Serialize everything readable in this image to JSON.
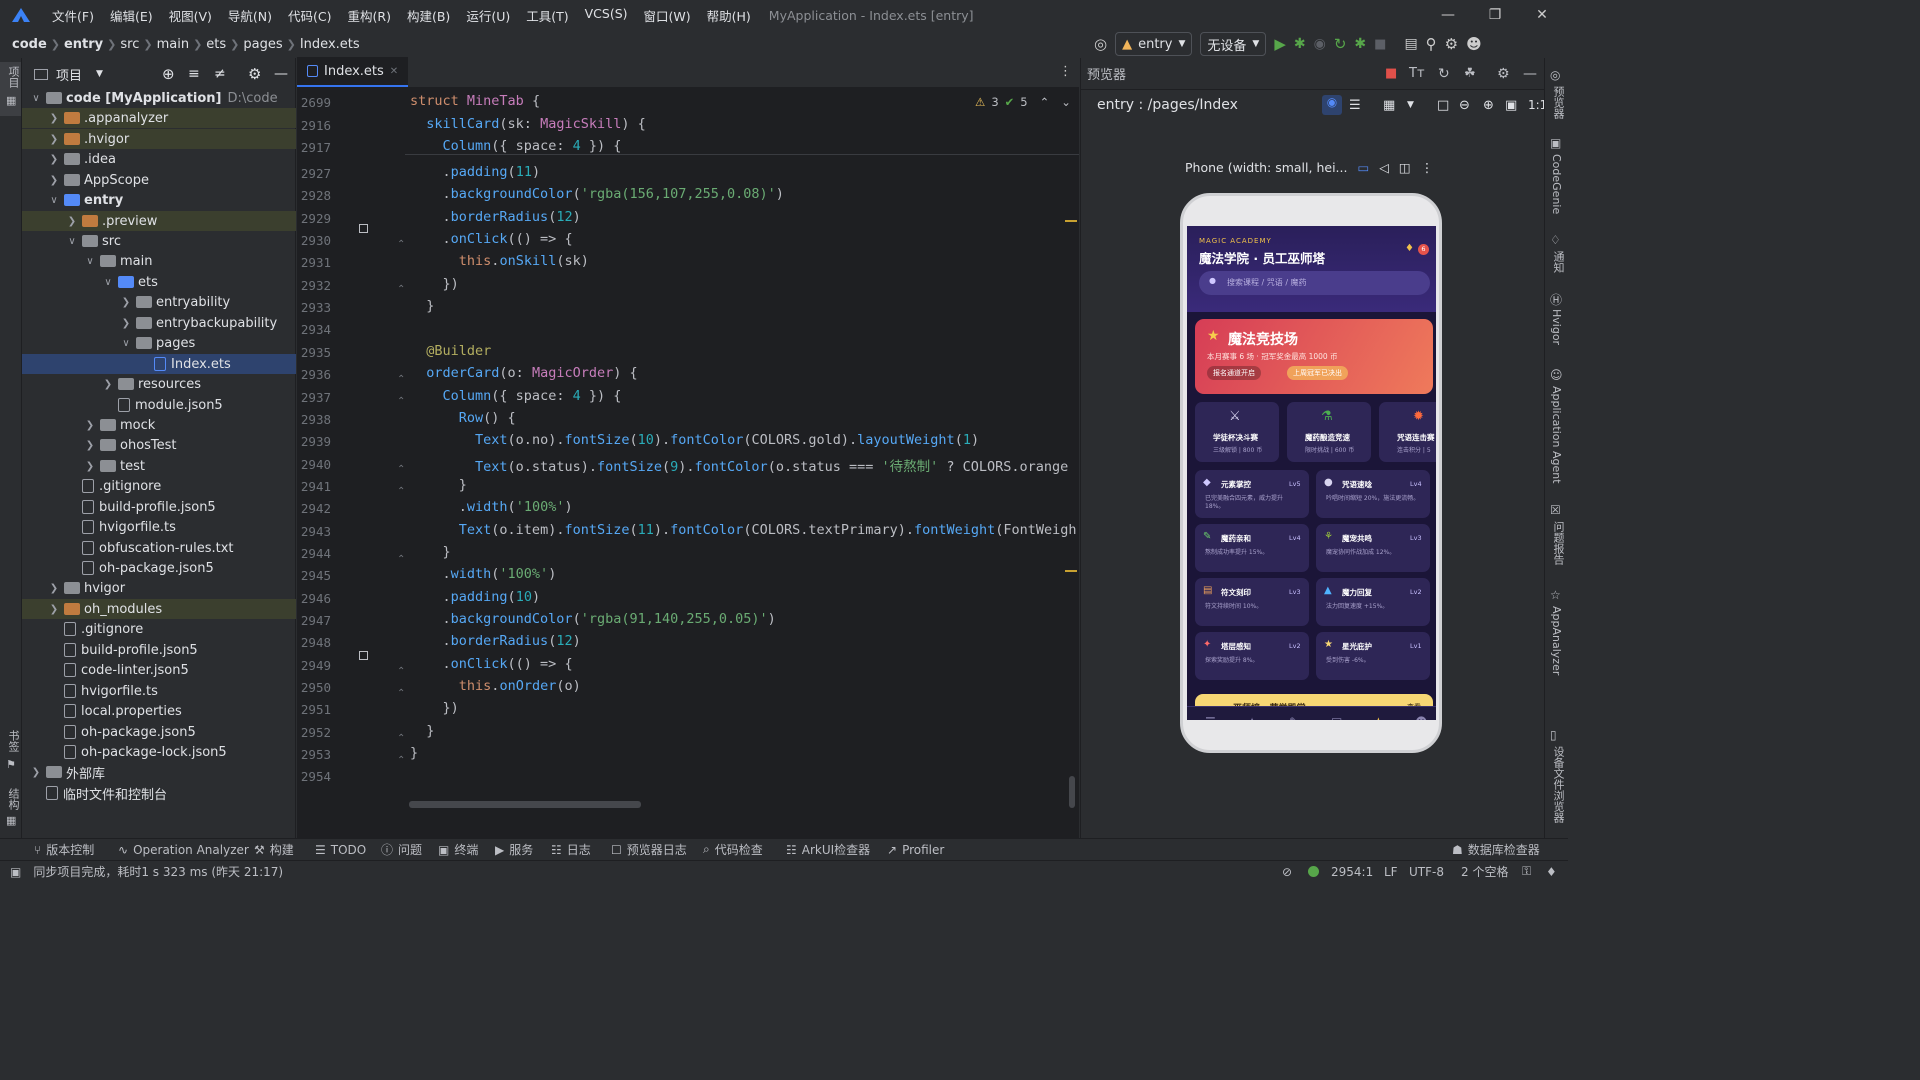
{
  "menubar": {
    "items": [
      "文件(F)",
      "编辑(E)",
      "视图(V)",
      "导航(N)",
      "代码(C)",
      "重构(R)",
      "构建(B)",
      "运行(U)",
      "工具(T)",
      "VCS(S)",
      "窗口(W)",
      "帮助(H)"
    ],
    "window_title": "MyApplication - Index.ets [entry]"
  },
  "breadcrumb": [
    "code",
    "entry",
    "src",
    "main",
    "ets",
    "pages",
    "Index.ets"
  ],
  "toolbar": {
    "run_config": "entry",
    "device": "无设备"
  },
  "project_panel": {
    "title": "项目",
    "tree": [
      {
        "label": "code [MyApplication]",
        "path": "D:\\code",
        "indent": 0,
        "chevron": "down",
        "kind": "folder-plain",
        "style": "bold"
      },
      {
        "label": ".appanalyzer",
        "indent": 1,
        "chevron": "right",
        "kind": "folder-orange",
        "style": "hl"
      },
      {
        "label": ".hvigor",
        "indent": 1,
        "chevron": "right",
        "kind": "folder-orange",
        "style": "hl"
      },
      {
        "label": ".idea",
        "indent": 1,
        "chevron": "right",
        "kind": "folder-plain"
      },
      {
        "label": "AppScope",
        "indent": 1,
        "chevron": "right",
        "kind": "folder-plain"
      },
      {
        "label": "entry",
        "indent": 1,
        "chevron": "down",
        "kind": "folder-blue",
        "style": "bold"
      },
      {
        "label": ".preview",
        "indent": 2,
        "chevron": "right",
        "kind": "folder-orange",
        "style": "hl"
      },
      {
        "label": "src",
        "indent": 2,
        "chevron": "down",
        "kind": "folder-plain"
      },
      {
        "label": "main",
        "indent": 3,
        "chevron": "down",
        "kind": "folder-plain"
      },
      {
        "label": "ets",
        "indent": 4,
        "chevron": "down",
        "kind": "folder-blue"
      },
      {
        "label": "entryability",
        "indent": 5,
        "chevron": "right",
        "kind": "folder-plain"
      },
      {
        "label": "entrybackupability",
        "indent": 5,
        "chevron": "right",
        "kind": "folder-plain"
      },
      {
        "label": "pages",
        "indent": 5,
        "chevron": "down",
        "kind": "folder-plain"
      },
      {
        "label": "Index.ets",
        "indent": 6,
        "chevron": "",
        "kind": "file-blue",
        "style": "sel"
      },
      {
        "label": "resources",
        "indent": 4,
        "chevron": "right",
        "kind": "folder-plain"
      },
      {
        "label": "module.json5",
        "indent": 4,
        "chevron": "",
        "kind": "file"
      },
      {
        "label": "mock",
        "indent": 3,
        "chevron": "right",
        "kind": "folder-plain"
      },
      {
        "label": "ohosTest",
        "indent": 3,
        "chevron": "right",
        "kind": "folder-plain"
      },
      {
        "label": "test",
        "indent": 3,
        "chevron": "right",
        "kind": "folder-plain"
      },
      {
        "label": ".gitignore",
        "indent": 2,
        "chevron": "",
        "kind": "file"
      },
      {
        "label": "build-profile.json5",
        "indent": 2,
        "chevron": "",
        "kind": "file"
      },
      {
        "label": "hvigorfile.ts",
        "indent": 2,
        "chevron": "",
        "kind": "file"
      },
      {
        "label": "obfuscation-rules.txt",
        "indent": 2,
        "chevron": "",
        "kind": "file"
      },
      {
        "label": "oh-package.json5",
        "indent": 2,
        "chevron": "",
        "kind": "file"
      },
      {
        "label": "hvigor",
        "indent": 1,
        "chevron": "right",
        "kind": "folder-plain"
      },
      {
        "label": "oh_modules",
        "indent": 1,
        "chevron": "right",
        "kind": "folder-orange",
        "style": "hl"
      },
      {
        "label": ".gitignore",
        "indent": 1,
        "chevron": "",
        "kind": "file"
      },
      {
        "label": "build-profile.json5",
        "indent": 1,
        "chevron": "",
        "kind": "file"
      },
      {
        "label": "code-linter.json5",
        "indent": 1,
        "chevron": "",
        "kind": "file"
      },
      {
        "label": "hvigorfile.ts",
        "indent": 1,
        "chevron": "",
        "kind": "file"
      },
      {
        "label": "local.properties",
        "indent": 1,
        "chevron": "",
        "kind": "file"
      },
      {
        "label": "oh-package.json5",
        "indent": 1,
        "chevron": "",
        "kind": "file"
      },
      {
        "label": "oh-package-lock.json5",
        "indent": 1,
        "chevron": "",
        "kind": "file"
      },
      {
        "label": "外部库",
        "indent": 0,
        "chevron": "right",
        "kind": "folder-plain"
      },
      {
        "label": "临时文件和控制台",
        "indent": 0,
        "chevron": "",
        "kind": "file"
      }
    ]
  },
  "left_strip": {
    "project": "项目",
    "bookmarks": "书签",
    "structure": "结构"
  },
  "editor": {
    "tab": "Index.ets",
    "inspections": {
      "warnings": "3",
      "ok": "5"
    },
    "sticky": [
      {
        "ln": "2699",
        "tokens": [
          [
            "kw",
            "struct "
          ],
          [
            "ty",
            "MineTab "
          ],
          [
            "cls",
            "{"
          ]
        ]
      },
      {
        "ln": "2916",
        "tokens": [
          [
            "cls",
            "  "
          ],
          [
            "fn",
            "skillCard"
          ],
          [
            "cls",
            "(sk: "
          ],
          [
            "ty",
            "MagicSkill"
          ],
          [
            "cls",
            ") {"
          ]
        ]
      },
      {
        "ln": "2917",
        "tokens": [
          [
            "cls",
            "    "
          ],
          [
            "fn",
            "Column"
          ],
          [
            "cls",
            "({ space: "
          ],
          [
            "num",
            "4"
          ],
          [
            "cls",
            " }) {"
          ]
        ]
      }
    ],
    "lines": [
      {
        "ln": "2927",
        "tokens": [
          [
            "cls",
            "    ."
          ],
          [
            "fn",
            "padding"
          ],
          [
            "cls",
            "("
          ],
          [
            "num",
            "11"
          ],
          [
            "cls",
            ")"
          ]
        ]
      },
      {
        "ln": "2928",
        "tokens": [
          [
            "cls",
            "    ."
          ],
          [
            "fn",
            "backgroundColor"
          ],
          [
            "cls",
            "("
          ],
          [
            "str",
            "'rgba(156,107,255,0.08)'"
          ],
          [
            "cls",
            ")"
          ]
        ]
      },
      {
        "ln": "2929",
        "tokens": [
          [
            "cls",
            "    ."
          ],
          [
            "fn",
            "borderRadius"
          ],
          [
            "cls",
            "("
          ],
          [
            "num",
            "12"
          ],
          [
            "cls",
            ")"
          ]
        ]
      },
      {
        "ln": "2930",
        "tokens": [
          [
            "cls",
            "    ."
          ],
          [
            "fn",
            "onClick"
          ],
          [
            "cls",
            "(() => {"
          ]
        ]
      },
      {
        "ln": "2931",
        "tokens": [
          [
            "cls",
            "      "
          ],
          [
            "kw",
            "this"
          ],
          [
            "cls",
            "."
          ],
          [
            "fn",
            "onSkill"
          ],
          [
            "cls",
            "(sk)"
          ]
        ]
      },
      {
        "ln": "2932",
        "tokens": [
          [
            "cls",
            "    })"
          ]
        ]
      },
      {
        "ln": "2933",
        "tokens": [
          [
            "cls",
            "  }"
          ]
        ]
      },
      {
        "ln": "2934",
        "tokens": [
          [
            "cls",
            ""
          ]
        ]
      },
      {
        "ln": "2935",
        "tokens": [
          [
            "cls",
            "  "
          ],
          [
            "ann",
            "@Builder"
          ]
        ]
      },
      {
        "ln": "2936",
        "tokens": [
          [
            "cls",
            "  "
          ],
          [
            "fn",
            "orderCard"
          ],
          [
            "cls",
            "(o: "
          ],
          [
            "ty",
            "MagicOrder"
          ],
          [
            "cls",
            ") {"
          ]
        ]
      },
      {
        "ln": "2937",
        "tokens": [
          [
            "cls",
            "    "
          ],
          [
            "fn",
            "Column"
          ],
          [
            "cls",
            "({ space: "
          ],
          [
            "num",
            "4"
          ],
          [
            "cls",
            " }) {"
          ]
        ]
      },
      {
        "ln": "2938",
        "tokens": [
          [
            "cls",
            "      "
          ],
          [
            "fn",
            "Row"
          ],
          [
            "cls",
            "() {"
          ]
        ]
      },
      {
        "ln": "2939",
        "tokens": [
          [
            "cls",
            "        "
          ],
          [
            "fn",
            "Text"
          ],
          [
            "cls",
            "(o."
          ],
          [
            "cls",
            "no"
          ],
          [
            "cls",
            ")."
          ],
          [
            "fn",
            "fontSize"
          ],
          [
            "cls",
            "("
          ],
          [
            "num",
            "10"
          ],
          [
            "cls",
            ")."
          ],
          [
            "fn",
            "fontColor"
          ],
          [
            "cls",
            "(COLORS."
          ],
          [
            "cls",
            "gold"
          ],
          [
            "cls",
            ")."
          ],
          [
            "fn",
            "layoutWeight"
          ],
          [
            "cls",
            "("
          ],
          [
            "num",
            "1"
          ],
          [
            "cls",
            ")"
          ]
        ]
      },
      {
        "ln": "2940",
        "tokens": [
          [
            "cls",
            "        "
          ],
          [
            "fn",
            "Text"
          ],
          [
            "cls",
            "(o.status)."
          ],
          [
            "fn",
            "fontSize"
          ],
          [
            "cls",
            "("
          ],
          [
            "num",
            "9"
          ],
          [
            "cls",
            ")."
          ],
          [
            "fn",
            "fontColor"
          ],
          [
            "cls",
            "(o.status === "
          ],
          [
            "str",
            "'待熬制'"
          ],
          [
            "cls",
            " ? COLORS.orange"
          ]
        ]
      },
      {
        "ln": "2941",
        "tokens": [
          [
            "cls",
            "      }"
          ]
        ]
      },
      {
        "ln": "2942",
        "tokens": [
          [
            "cls",
            "      ."
          ],
          [
            "fn",
            "width"
          ],
          [
            "cls",
            "("
          ],
          [
            "str",
            "'100%'"
          ],
          [
            "cls",
            ")"
          ]
        ]
      },
      {
        "ln": "2943",
        "tokens": [
          [
            "cls",
            "      "
          ],
          [
            "fn",
            "Text"
          ],
          [
            "cls",
            "(o.item)."
          ],
          [
            "fn",
            "fontSize"
          ],
          [
            "cls",
            "("
          ],
          [
            "num",
            "11"
          ],
          [
            "cls",
            ")."
          ],
          [
            "fn",
            "fontColor"
          ],
          [
            "cls",
            "(COLORS.textPrimary)."
          ],
          [
            "fn",
            "fontWeight"
          ],
          [
            "cls",
            "(FontWeigh"
          ]
        ]
      },
      {
        "ln": "2944",
        "tokens": [
          [
            "cls",
            "    }"
          ]
        ]
      },
      {
        "ln": "2945",
        "tokens": [
          [
            "cls",
            "    ."
          ],
          [
            "fn",
            "width"
          ],
          [
            "cls",
            "("
          ],
          [
            "str",
            "'100%'"
          ],
          [
            "cls",
            ")"
          ]
        ]
      },
      {
        "ln": "2946",
        "tokens": [
          [
            "cls",
            "    ."
          ],
          [
            "fn",
            "padding"
          ],
          [
            "cls",
            "("
          ],
          [
            "num",
            "10"
          ],
          [
            "cls",
            ")"
          ]
        ]
      },
      {
        "ln": "2947",
        "tokens": [
          [
            "cls",
            "    ."
          ],
          [
            "fn",
            "backgroundColor"
          ],
          [
            "cls",
            "("
          ],
          [
            "str",
            "'rgba(91,140,255,0.05)'"
          ],
          [
            "cls",
            ")"
          ]
        ]
      },
      {
        "ln": "2948",
        "tokens": [
          [
            "cls",
            "    ."
          ],
          [
            "fn",
            "borderRadius"
          ],
          [
            "cls",
            "("
          ],
          [
            "num",
            "12"
          ],
          [
            "cls",
            ")"
          ]
        ]
      },
      {
        "ln": "2949",
        "tokens": [
          [
            "cls",
            "    ."
          ],
          [
            "fn",
            "onClick"
          ],
          [
            "cls",
            "(() => {"
          ]
        ]
      },
      {
        "ln": "2950",
        "tokens": [
          [
            "cls",
            "      "
          ],
          [
            "kw",
            "this"
          ],
          [
            "cls",
            "."
          ],
          [
            "fn",
            "onOrder"
          ],
          [
            "cls",
            "(o)"
          ]
        ]
      },
      {
        "ln": "2951",
        "tokens": [
          [
            "cls",
            "    })"
          ]
        ]
      },
      {
        "ln": "2952",
        "tokens": [
          [
            "cls",
            "  }"
          ]
        ]
      },
      {
        "ln": "2953",
        "tokens": [
          [
            "cls",
            "}"
          ]
        ]
      },
      {
        "ln": "2954",
        "tokens": [
          [
            "cls",
            ""
          ]
        ]
      }
    ]
  },
  "preview": {
    "title": "预览器",
    "route": "entry : /pages/Index",
    "device_label": "Phone (width: small, hei...",
    "app": {
      "brand": "MAGIC ACADEMY",
      "title": "魔法学院 · 员工巫师塔",
      "badge": "6",
      "search": "搜索课程 / 咒语 / 魔药",
      "arena_title": "魔法竞技场",
      "arena_sub": "本月赛事 6 场 · 冠军奖金最高 1000 币",
      "arena_btn1": "报名通道开启",
      "arena_btn2": "上周冠军已决出",
      "events": [
        {
          "title": "学徒杯决斗赛",
          "sub": "三级解锁 | 800 币"
        },
        {
          "title": "魔药酿造竞速",
          "sub": "限时挑战 | 600 币"
        },
        {
          "title": "咒语连击赛",
          "sub": "连击积分 | 5"
        }
      ],
      "skills": [
        {
          "title": "元素掌控",
          "lv": "Lv5",
          "sub": "已完美融合四元素，威力提升 18%。"
        },
        {
          "title": "咒语速唸",
          "lv": "Lv4",
          "sub": "吟唱时间缩短 20%，施法更流畅。"
        },
        {
          "title": "魔药亲和",
          "lv": "Lv4",
          "sub": "熬制成功率提升 15%。"
        },
        {
          "title": "魔宠共鸣",
          "lv": "Lv3",
          "sub": "魔宠协同作战加成 12%。"
        },
        {
          "title": "符文刻印",
          "lv": "Lv3",
          "sub": "符文持续时间 10%。"
        },
        {
          "title": "魔力回复",
          "lv": "Lv2",
          "sub": "法力回复速度 +15%。"
        },
        {
          "title": "塔层感知",
          "lv": "Lv2",
          "sub": "探索奖励提升 8%。"
        },
        {
          "title": "星光庇护",
          "lv": "Lv1",
          "sub": "受到伤害 -6%。"
        }
      ],
      "ranking_title": "巫师榜 · 荣誉殿堂",
      "ranking_more": "查看"
    }
  },
  "right_strip": [
    "预览器",
    "CodeGenie",
    "通知",
    "Hvigor",
    "Application Agent",
    "问题报告",
    "AppAnalyzer",
    "设备文件浏览器"
  ],
  "bottom_tools": [
    "版本控制",
    "Operation Analyzer",
    "构建",
    "TODO",
    "问题",
    "终端",
    "服务",
    "日志",
    "预览器日志",
    "代码检查",
    "ArkUI检查器",
    "Profiler",
    "数据库检查器"
  ],
  "status": {
    "message": "同步项目完成，耗时1 s 323 ms (昨天 21:17)",
    "position": "2954:1",
    "line_sep": "LF",
    "encoding": "UTF-8",
    "indent": "2 个空格"
  }
}
